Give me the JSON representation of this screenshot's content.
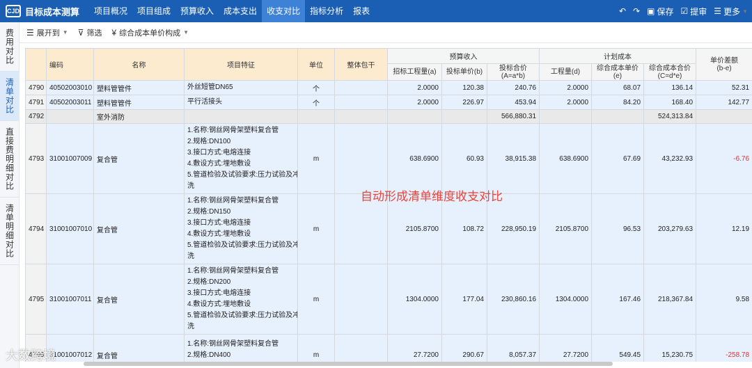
{
  "app": {
    "logo_text": "CJD",
    "title": "目标成本测算"
  },
  "nav": [
    {
      "label": "项目概况",
      "active": false
    },
    {
      "label": "项目组成",
      "active": false
    },
    {
      "label": "预算收入",
      "active": false
    },
    {
      "label": "成本支出",
      "active": false
    },
    {
      "label": "收支对比",
      "active": true
    },
    {
      "label": "指标分析",
      "active": false
    },
    {
      "label": "报表",
      "active": false
    }
  ],
  "top_right": {
    "undo_icon": "undo-icon",
    "redo_icon": "redo-icon",
    "save": "保存",
    "submit": "提审",
    "more": "更多"
  },
  "side_tabs": [
    {
      "label": "费用对比",
      "active": false
    },
    {
      "label": "清单对比",
      "active": true
    },
    {
      "label": "直接费明细对比",
      "active": false
    },
    {
      "label": "清单明细对比",
      "active": false
    }
  ],
  "toolbar": {
    "expand": "展开到",
    "filter": "筛选",
    "composition": "综合成本单价构成"
  },
  "table": {
    "headers": {
      "code": "编码",
      "name": "名称",
      "feature": "项目特征",
      "unit": "单位",
      "package": "整体包干",
      "budget_group": "预算收入",
      "plan_group": "计划成本",
      "bid_qty": "招标工程量(a)",
      "bid_price": "投标单价(b)",
      "bid_total_1": "投标合价",
      "bid_total_2": "(A=a*b)",
      "qty": "工程量(d)",
      "unit_cost": "综合成本单价(e)",
      "cost_total_1": "综合成本合价",
      "cost_total_2": "(C=d*e)",
      "diff_1": "单价差额",
      "diff_2": "(b-e)"
    },
    "rows": [
      {
        "no": "4790",
        "code": "40502003010",
        "name": "塑料管管件",
        "feature": [
          "外丝短管DN65"
        ],
        "unit": "个",
        "a": "2.0000",
        "b": "120.38",
        "A": "240.76",
        "d": "2.0000",
        "e": "68.07",
        "C": "136.14",
        "diff": "52.31",
        "neg": false,
        "type": "main"
      },
      {
        "no": "4791",
        "code": "40502003011",
        "name": "塑料管管件",
        "feature": [
          "平行活接头"
        ],
        "unit": "个",
        "a": "2.0000",
        "b": "226.97",
        "A": "453.94",
        "d": "2.0000",
        "e": "84.20",
        "C": "168.40",
        "diff": "142.77",
        "neg": false,
        "type": "main"
      },
      {
        "no": "4792",
        "code": "",
        "name": "室外消防",
        "feature": [],
        "unit": "",
        "a": "",
        "b": "",
        "A": "566,880.31",
        "d": "",
        "e": "",
        "C": "524,313.84",
        "diff": "",
        "neg": false,
        "type": "group"
      },
      {
        "no": "4793",
        "code": "31001007009",
        "name": "复合管",
        "feature": [
          "1.名称:钢丝网骨架塑料复合管",
          "2.规格:DN100",
          "3.接口方式:电熔连接",
          "4.敷设方式:埋地敷设",
          "5.管道检验及试验要求:压力试验及冲",
          "洗"
        ],
        "unit": "m",
        "a": "638.6900",
        "b": "60.93",
        "A": "38,915.38",
        "d": "638.6900",
        "e": "67.69",
        "C": "43,232.93",
        "diff": "-6.76",
        "neg": true,
        "type": "tall"
      },
      {
        "no": "4794",
        "code": "31001007010",
        "name": "复合管",
        "feature": [
          "1.名称:钢丝网骨架塑料复合管",
          "2.规格:DN150",
          "3.接口方式:电熔连接",
          "4.敷设方式:埋地敷设",
          "5.管道检验及试验要求:压力试验及冲",
          "洗"
        ],
        "unit": "m",
        "a": "2105.8700",
        "b": "108.72",
        "A": "228,950.19",
        "d": "2105.8700",
        "e": "96.53",
        "C": "203,279.63",
        "diff": "12.19",
        "neg": false,
        "type": "tall"
      },
      {
        "no": "4795",
        "code": "31001007011",
        "name": "复合管",
        "feature": [
          "1.名称:钢丝网骨架塑料复合管",
          "2.规格:DN200",
          "3.接口方式:电熔连接",
          "4.敷设方式:埋地敷设",
          "5.管道检验及试验要求:压力试验及冲",
          "洗"
        ],
        "unit": "m",
        "a": "1304.0000",
        "b": "177.04",
        "A": "230,860.16",
        "d": "1304.0000",
        "e": "167.46",
        "C": "218,367.84",
        "diff": "9.58",
        "neg": false,
        "type": "tall"
      },
      {
        "no": "4796",
        "code": "31001007012",
        "name": "复合管",
        "feature": [
          "1.名称:钢丝网骨架塑料复合管",
          "2.规格:DN400",
          "3.接口方式:电熔连接"
        ],
        "unit": "m",
        "a": "27.7200",
        "b": "290.67",
        "A": "8,057.37",
        "d": "27.7200",
        "e": "549.45",
        "C": "15,230.75",
        "diff": "-258.78",
        "neg": true,
        "type": "tall"
      }
    ]
  },
  "overlay_text": "自动形成清单维度收支对比",
  "watermark_text": "大数跨境"
}
